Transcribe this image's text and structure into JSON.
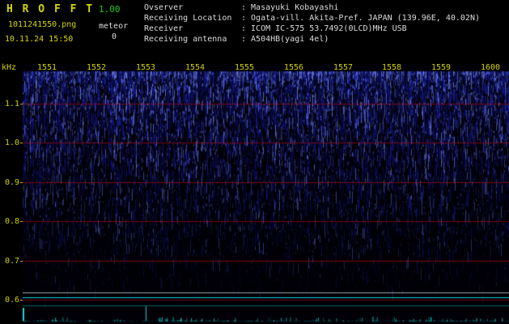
{
  "app": {
    "title": "H R O F F T",
    "version": "1.00",
    "filename": "1011241550.png",
    "counter_label": "meteor",
    "counter_value": "0",
    "datetime": "10.11.24 15:50"
  },
  "header": {
    "separator": ":",
    "rows": [
      {
        "label": "Ovserver",
        "value": "Masayuki Kobayashi"
      },
      {
        "label": "Receiving Location",
        "value": "Ogata-vill. Akita-Pref. JAPAN (139.96E, 40.02N)"
      },
      {
        "label": "Receiver",
        "value": "ICOM IC-575 53.7492(0LCD)MHz USB"
      },
      {
        "label": "Receiving antenna",
        "value": "A504HB(yagi 4el)"
      }
    ]
  },
  "spectrogram": {
    "y_axis_unit": "kHz",
    "time_labels": [
      "1551",
      "1552",
      "1553",
      "1554",
      "1555",
      "1556",
      "1557",
      "1558",
      "1559",
      "1600"
    ],
    "freq_labels": [
      "1.1",
      "1.0",
      "0.9",
      "0.8",
      "0.7",
      "0.6"
    ],
    "colors": {
      "background": "#000006",
      "noise_blue": "#1e28e6",
      "noise_bright": "#6e82ff",
      "grid_red": "#5c0000",
      "grid_red_overlay": "#8c0a0a",
      "carrier_white": "#c8dcdc",
      "carrier_cyan": "#00ebeb",
      "carrier_cyan_dim": "#00a0aa",
      "tick_cyan": "#00c8c8",
      "label_yellow": "#d2d200"
    }
  }
}
